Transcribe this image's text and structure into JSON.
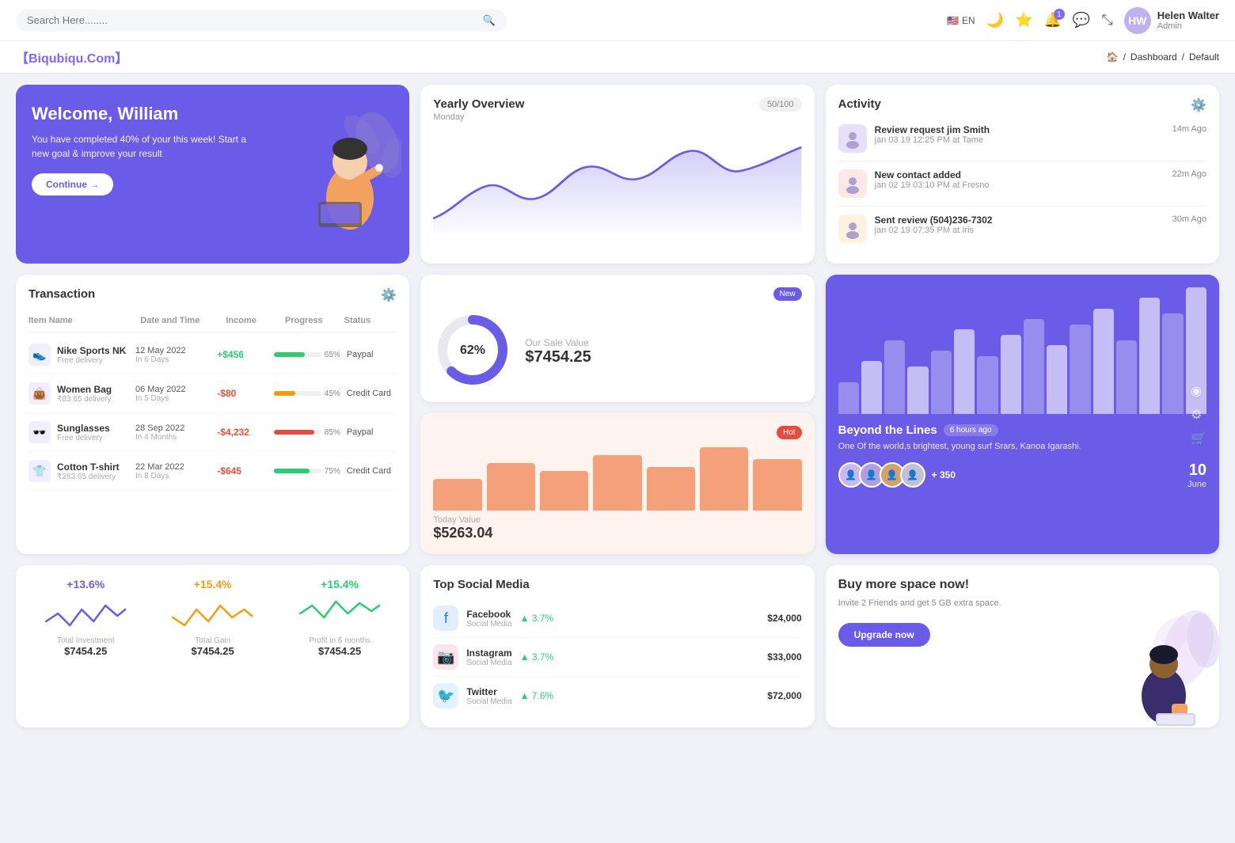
{
  "topnav": {
    "search_placeholder": "Search Here........",
    "lang": "EN",
    "notifications_count": "1",
    "user_name": "Helen Walter",
    "user_role": "Admin",
    "user_initials": "HW"
  },
  "breadcrumb": {
    "logo": "【Biqubiqu.Com】",
    "home": "🏠",
    "separator": "/",
    "dashboard": "Dashboard",
    "current": "Default"
  },
  "welcome": {
    "title": "Welcome, William",
    "subtitle": "You have completed 40% of your this week! Start a new goal & improve your result",
    "button": "Continue →"
  },
  "yearly": {
    "title": "Yearly Overview",
    "subtitle": "Monday",
    "badge": "50/100"
  },
  "activity": {
    "title": "Activity",
    "items": [
      {
        "title": "Review request jim Smith",
        "sub": "jan 03 19 12:25 PM at Tame",
        "time": "14m Ago",
        "emoji": "👤"
      },
      {
        "title": "New contact added",
        "sub": "jan 02 19 03:10 PM at Fresno",
        "time": "22m Ago",
        "emoji": "👤"
      },
      {
        "title": "Sent review (504)236-7302",
        "sub": "jan 02 19 07:35 PM at Iris",
        "time": "30m Ago",
        "emoji": "📋"
      }
    ]
  },
  "transaction": {
    "title": "Transaction",
    "columns": [
      "Item Name",
      "Date and Time",
      "Income",
      "Progress",
      "Status"
    ],
    "rows": [
      {
        "name": "Nike Sports NK",
        "sub": "Free delivery",
        "date": "12 May 2022",
        "date_sub": "In 6 Days",
        "income": "+$456",
        "income_type": "pos",
        "progress": 65,
        "progress_color": "#2ecc71",
        "status": "Paypal",
        "emoji": "👟"
      },
      {
        "name": "Women Bag",
        "sub": "₹83.65 delivery",
        "date": "06 May 2022",
        "date_sub": "In 5 Days",
        "income": "-$80",
        "income_type": "neg",
        "progress": 45,
        "progress_color": "#f39c12",
        "status": "Credit Card",
        "emoji": "👜"
      },
      {
        "name": "Sunglasses",
        "sub": "Free delivery",
        "date": "28 Sep 2022",
        "date_sub": "In 4 Months",
        "income": "-$4,232",
        "income_type": "neg",
        "progress": 85,
        "progress_color": "#e74c3c",
        "status": "Paypal",
        "emoji": "🕶️"
      },
      {
        "name": "Cotton T-shirt",
        "sub": "₹283.65 delivery",
        "date": "22 Mar 2022",
        "date_sub": "In 8 Days",
        "income": "-$645",
        "income_type": "neg",
        "progress": 75,
        "progress_color": "#2ecc71",
        "status": "Credit Card",
        "emoji": "👕"
      }
    ]
  },
  "sale_value": {
    "badge": "New",
    "donut_pct": "62%",
    "label": "Our Sale Value",
    "value": "$7454.25",
    "donut_filled": 62,
    "donut_color": "#6b5ce7"
  },
  "today_value": {
    "badge": "Hot",
    "label": "Today Value",
    "value": "$5263.04",
    "bars": [
      40,
      60,
      50,
      70,
      55,
      80,
      65
    ],
    "bar_color": "#f4a07a"
  },
  "beyond": {
    "title": "Beyond the Lines",
    "time_ago": "6 hours ago",
    "sub": "One Of the world,s brightest, young surf Srars, Kanoa Igarashi.",
    "avatars": [
      "👤",
      "👤",
      "👤",
      "👤"
    ],
    "plus_count": "+ 350",
    "date": "10",
    "month": "June",
    "bars": [
      30,
      50,
      70,
      45,
      60,
      80,
      55,
      75,
      90,
      65,
      85,
      100,
      70,
      110,
      95,
      120
    ]
  },
  "stats": [
    {
      "pct": "+13.6%",
      "color": "purple",
      "label": "Total Investment",
      "value": "$7454.25"
    },
    {
      "pct": "+15.4%",
      "color": "orange",
      "label": "Total Gain",
      "value": "$7454.25"
    },
    {
      "pct": "+15.4%",
      "color": "green",
      "label": "Profit in 6 months",
      "value": "$7454.25"
    }
  ],
  "social_media": {
    "title": "Top Social Media",
    "items": [
      {
        "name": "Facebook",
        "type": "Social Media",
        "pct": "3.7%",
        "amount": "$24,000",
        "color": "#1877f2",
        "icon": "f"
      },
      {
        "name": "Instagram",
        "type": "Social Media",
        "pct": "3.7%",
        "amount": "$33,000",
        "color": "#e1306c",
        "icon": "📷"
      },
      {
        "name": "Twitter",
        "type": "Social Media",
        "pct": "7.6%",
        "amount": "$72,000",
        "color": "#1da1f2",
        "icon": "🐦"
      }
    ]
  },
  "space": {
    "title": "Buy more space now!",
    "sub": "Invite 2 Friends and get 5 GB extra space.",
    "button": "Upgrade now"
  }
}
